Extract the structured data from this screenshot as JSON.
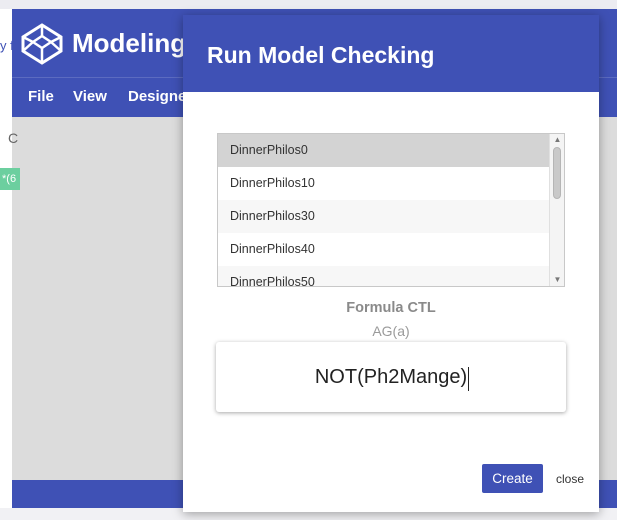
{
  "app": {
    "title": "Modeling",
    "left_partial": "y f",
    "left_c": "C",
    "left_chip": "*(6",
    "menu": [
      "File",
      "View",
      "Designe"
    ],
    "colors": {
      "primary": "#3f51b5",
      "canvas": "#dcdcdc",
      "chip": "#6ccf9f"
    },
    "logo_icon": "codepen-cube-icon"
  },
  "modal": {
    "title": "Run Model Checking",
    "list": {
      "items": [
        "DinnerPhilos0",
        "DinnerPhilos10",
        "DinnerPhilos30",
        "DinnerPhilos40",
        "DinnerPhilos50"
      ],
      "selected": "DinnerPhilos0"
    },
    "formula_label": "Formula CTL",
    "formula_example": "AG(a)",
    "formula_value": "NOT(Ph2Mange)",
    "create_label": "Create",
    "close_label": "close"
  }
}
